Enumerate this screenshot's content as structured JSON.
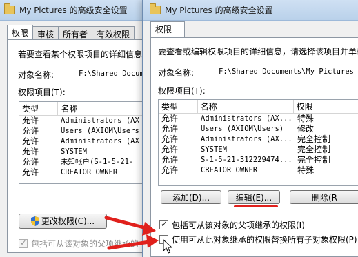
{
  "back_window": {
    "title": "My Pictures 的高级安全设置",
    "tabs": [
      "权限",
      "审核",
      "所有者",
      "有效权限"
    ],
    "description": "若要查看某个权限项目的详细信息",
    "object_name_label": "对象名称:",
    "object_name_value": "F:\\Shared Docum",
    "entries_label": "权限项目(T):",
    "columns": [
      "类型",
      "名称"
    ],
    "rows": [
      {
        "type": "允许",
        "name": "Administrators (AX"
      },
      {
        "type": "允许",
        "name": "Users (AXIOM\\Users"
      },
      {
        "type": "允许",
        "name": "Administrators (AX"
      },
      {
        "type": "允许",
        "name": "SYSTEM"
      },
      {
        "type": "允许",
        "name": "未知帐户(S-1-5-21-"
      },
      {
        "type": "允许",
        "name": "CREATOR OWNER"
      }
    ],
    "change_permissions_button": "更改权限(C)...",
    "inherit_checkbox_label": "包括可从该对象的父项继承的"
  },
  "front_window": {
    "title": "My Pictures 的高级安全设置",
    "tab": "权限",
    "description": "要查看或编辑权限项目的详细信息，请选择该项目并单击",
    "object_name_label": "对象名称:",
    "object_name_value": "F:\\Shared Documents\\My Pictures",
    "entries_label": "权限项目(T):",
    "columns": [
      "类型",
      "名称",
      "权限"
    ],
    "rows": [
      {
        "type": "允许",
        "name": "Administrators (AX...",
        "perm": "特殊"
      },
      {
        "type": "允许",
        "name": "Users (AXIOM\\Users)",
        "perm": "修改"
      },
      {
        "type": "允许",
        "name": "Administrators (AX...",
        "perm": "完全控制"
      },
      {
        "type": "允许",
        "name": "SYSTEM",
        "perm": "完全控制"
      },
      {
        "type": "允许",
        "name": "S-1-5-21-312229474...",
        "perm": "完全控制"
      },
      {
        "type": "允许",
        "name": "CREATOR OWNER",
        "perm": "特殊"
      }
    ],
    "add_button": "添加(D)...",
    "edit_button": "编辑(E)...",
    "remove_button": "删除(R",
    "inherit_checkbox_label": "包括可从该对象的父项继承的权限(I)",
    "inherit_checkbox_checked": true,
    "replace_checkbox_label": "使用可从此对象继承的权限替换所有子对象权限(P)",
    "replace_checkbox_checked": false
  },
  "colors": {
    "annotation_red": "#e0201c",
    "titlebar": "#c4d8ef",
    "window_bg": "#f0f0f0"
  }
}
